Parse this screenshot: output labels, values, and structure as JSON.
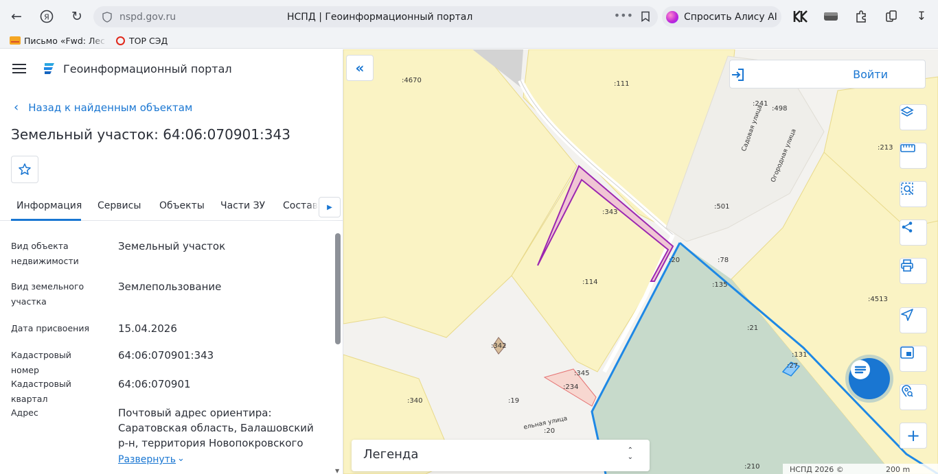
{
  "browser": {
    "host": "nspd.gov.ru",
    "tab_title": "НСПД | Геоинформационный портал",
    "alice_label": "Спросить Алису AI",
    "bookmarks": [
      {
        "label": "Письмо «Fwd: Лес"
      },
      {
        "label": "ТОР СЭД"
      }
    ]
  },
  "portal": {
    "title": "Геоинформационный портал",
    "back_label": "Назад к найденным объектам",
    "object_title": "Земельный участок: 64:06:070901:343",
    "tabs": [
      "Информация",
      "Сервисы",
      "Объекты",
      "Части ЗУ",
      "Состав"
    ],
    "properties": [
      {
        "key": "Вид объекта недвижимости",
        "value": "Земельный участок"
      },
      {
        "key": "Вид земельного участка",
        "value": "Землепользование"
      },
      {
        "key": "Дата присвоения",
        "value": "15.04.2026"
      },
      {
        "key": "Кадастровый номер",
        "value": "64:06:070901:343"
      },
      {
        "key": "Кадастровый квартал",
        "value": "64:06:070901"
      },
      {
        "key": "Адрес",
        "value": "Почтовый адрес ориентира: Саратовская область, Балашовский р-н, территория Новопокровского"
      }
    ],
    "expand_label": "Развернуть"
  },
  "map": {
    "login_label": "Войти",
    "legend_label": "Легенда",
    "copyright": "НСПД 2026 ©",
    "scale_label": "200 m",
    "parcel_labels": [
      ":4670",
      ":111",
      ":241",
      ":498",
      ":213",
      ":343",
      ":501",
      ":20",
      ":78",
      ":114",
      ":135",
      ":4513",
      ":21",
      ":342",
      ":131",
      ":27",
      ":345",
      ":234",
      ":340",
      ":19",
      ":20",
      ":210"
    ],
    "street_labels": [
      "Садовая улица",
      "Огородная улица",
      "ельная улица"
    ],
    "colors": {
      "accent": "#1976d2",
      "parcel_fill": "#faf3c4",
      "forest_fill": "#c7dacb",
      "selected_outline": "#9c27b0",
      "boundary": "#1e88e5"
    }
  }
}
